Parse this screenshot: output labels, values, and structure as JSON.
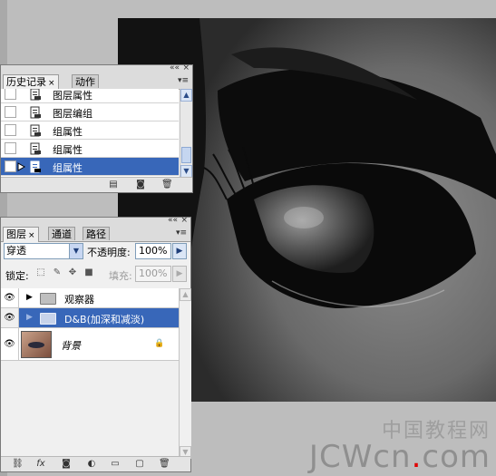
{
  "history_panel": {
    "tabs": [
      {
        "label": "历史记录",
        "close": "×"
      },
      {
        "label": "动作"
      }
    ],
    "items": [
      {
        "label": "图层属性",
        "selected": false
      },
      {
        "label": "图层编组",
        "selected": false
      },
      {
        "label": "组属性",
        "selected": false
      },
      {
        "label": "组属性",
        "selected": false
      },
      {
        "label": "组属性",
        "selected": true
      }
    ]
  },
  "layers_panel": {
    "tabs": [
      {
        "label": "图层",
        "close": "×"
      },
      {
        "label": "通道"
      },
      {
        "label": "路径"
      }
    ],
    "blend_mode": "穿透",
    "opacity_label": "不透明度:",
    "opacity_value": "100%",
    "lock_label": "锁定:",
    "fill_label": "填充:",
    "fill_value": "100%",
    "layers": [
      {
        "name": "观察器",
        "type": "group",
        "selected": false,
        "expanded": false
      },
      {
        "name": "D&B(加深和减淡)",
        "type": "group",
        "selected": true,
        "expanded": false
      },
      {
        "name": "背景",
        "type": "image",
        "selected": false,
        "locked": true
      }
    ],
    "footer_icons": [
      "link-icon",
      "fx-icon",
      "mask-icon",
      "adjustment-icon",
      "new-group-icon",
      "new-layer-icon",
      "trash-icon"
    ]
  },
  "watermark": {
    "cn": "中国教程网",
    "en_prefix": "JCWcn",
    "en_dot": ".",
    "en_suffix": "com",
    "dot_color": "#e10000"
  },
  "colors": {
    "selection": "#3867b9",
    "panel_bg": "#f0f0f0",
    "canvas_bg": "#bdbdbd"
  }
}
